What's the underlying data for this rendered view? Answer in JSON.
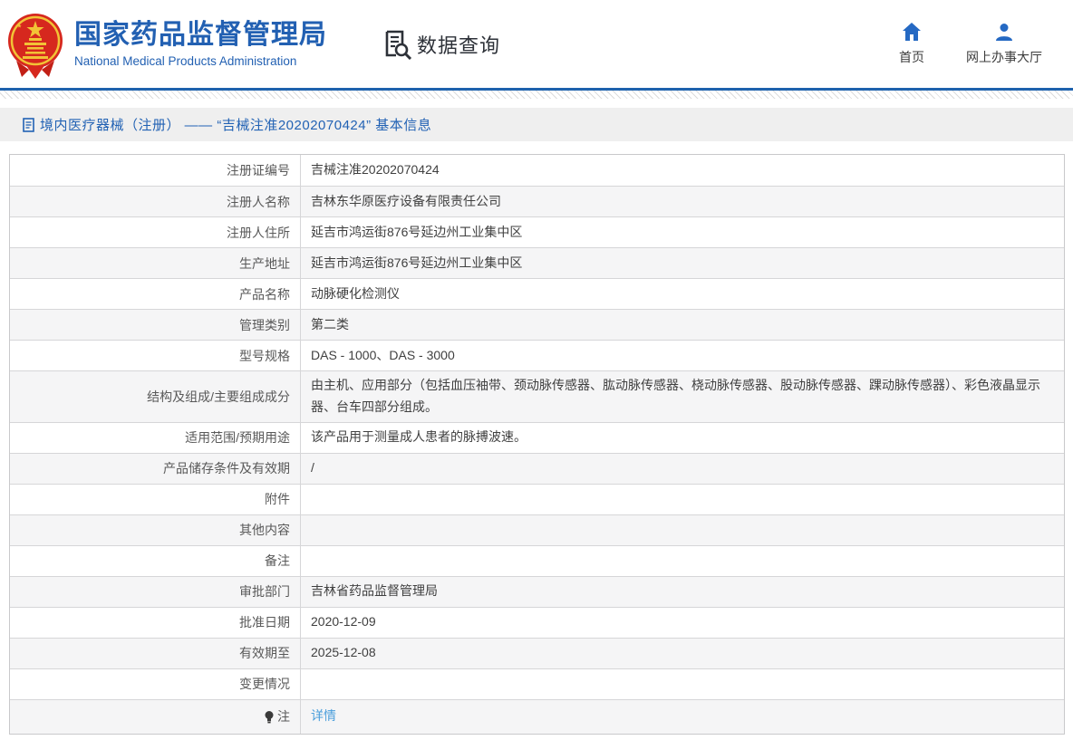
{
  "header": {
    "org_name_cn": "国家药品监督管理局",
    "org_name_en": "National Medical Products Administration",
    "section_title": "数据查询",
    "nav": [
      {
        "icon": "home-icon",
        "label": "首页"
      },
      {
        "icon": "user-icon",
        "label": "网上办事大厅"
      }
    ]
  },
  "breadcrumb": {
    "icon": "document-icon",
    "text": "境内医疗器械（注册） —— “吉械注准20202070424” 基本信息"
  },
  "table": {
    "rows": [
      {
        "label": "注册证编号",
        "value": "吉械注准20202070424"
      },
      {
        "label": "注册人名称",
        "value": "吉林东华原医疗设备有限责任公司"
      },
      {
        "label": "注册人住所",
        "value": "延吉市鸿运街876号延边州工业集中区"
      },
      {
        "label": "生产地址",
        "value": "延吉市鸿运街876号延边州工业集中区"
      },
      {
        "label": "产品名称",
        "value": "动脉硬化检测仪"
      },
      {
        "label": "管理类别",
        "value": "第二类"
      },
      {
        "label": "型号规格",
        "value": "DAS - 1000、DAS - 3000"
      },
      {
        "label": "结构及组成/主要组成成分",
        "value": "由主机、应用部分（包括血压袖带、颈动脉传感器、肱动脉传感器、桡动脉传感器、股动脉传感器、踝动脉传感器）、彩色液晶显示器、台车四部分组成。"
      },
      {
        "label": "适用范围/预期用途",
        "value": "该产品用于测量成人患者的脉搏波速。"
      },
      {
        "label": "产品储存条件及有效期",
        "value": "/"
      },
      {
        "label": "附件",
        "value": ""
      },
      {
        "label": "其他内容",
        "value": ""
      },
      {
        "label": "备注",
        "value": ""
      },
      {
        "label": "审批部门",
        "value": "吉林省药品监督管理局"
      },
      {
        "label": "批准日期",
        "value": "2020-12-09"
      },
      {
        "label": "有效期至",
        "value": "2025-12-08"
      },
      {
        "label": "变更情况",
        "value": ""
      },
      {
        "label": "注",
        "value": "详情",
        "icon": "bulb-icon",
        "link": true
      }
    ]
  },
  "colors": {
    "brand_blue": "#2260b2",
    "divider_blue": "#1e62ad",
    "icon_blue": "#2569c3",
    "link_blue": "#4a9edb",
    "crumb_bg": "#efefef",
    "row_alt_bg": "#f5f5f6",
    "border_gray": "#d6d6d8"
  }
}
